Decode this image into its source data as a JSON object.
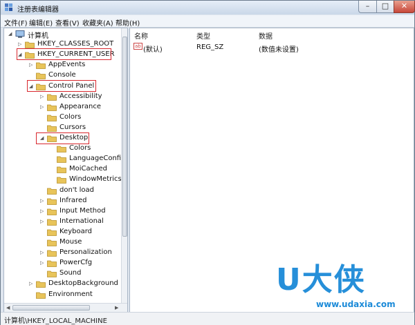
{
  "window": {
    "title": "注册表编辑器"
  },
  "window_controls": {
    "minimize": "–",
    "maximize": "□",
    "close": "✕"
  },
  "menu": [
    "文件(F)",
    "编辑(E)",
    "查看(V)",
    "收藏夹(A)",
    "帮助(H)"
  ],
  "tree": [
    {
      "label": "计算机",
      "arrow": "◢",
      "icon": "computer-icon"
    },
    {
      "label": "HKEY_CLASSES_ROOT",
      "arrow": "▷"
    },
    {
      "label": "HKEY_CURRENT_USER",
      "arrow": "◢"
    },
    {
      "label": "AppEvents",
      "arrow": "▷"
    },
    {
      "label": "Console",
      "arrow": ""
    },
    {
      "label": "Control Panel",
      "arrow": "◢"
    },
    {
      "label": "Accessibility",
      "arrow": "▷"
    },
    {
      "label": "Appearance",
      "arrow": "▷"
    },
    {
      "label": "Colors",
      "arrow": ""
    },
    {
      "label": "Cursors",
      "arrow": ""
    },
    {
      "label": "Desktop",
      "arrow": "◢"
    },
    {
      "label": "Colors",
      "arrow": ""
    },
    {
      "label": "LanguageConfig",
      "arrow": ""
    },
    {
      "label": "MoiCached",
      "arrow": ""
    },
    {
      "label": "WindowMetrics",
      "arrow": ""
    },
    {
      "label": "don't load",
      "arrow": ""
    },
    {
      "label": "Infrared",
      "arrow": "▷"
    },
    {
      "label": "Input Method",
      "arrow": "▷"
    },
    {
      "label": "International",
      "arrow": "▷"
    },
    {
      "label": "Keyboard",
      "arrow": ""
    },
    {
      "label": "Mouse",
      "arrow": ""
    },
    {
      "label": "Personalization",
      "arrow": "▷"
    },
    {
      "label": "PowerCfg",
      "arrow": "▷"
    },
    {
      "label": "Sound",
      "arrow": ""
    },
    {
      "label": "DesktopBackground",
      "arrow": "▷"
    },
    {
      "label": "Environment",
      "arrow": ""
    }
  ],
  "values": {
    "columns": {
      "name": "名称",
      "type": "类型",
      "data": "数据"
    },
    "rows": [
      {
        "icon": "ab",
        "name": "(默认)",
        "type": "REG_SZ",
        "data": "(数值未设置)"
      }
    ]
  },
  "status": {
    "path": "计算机\\HKEY_LOCAL_MACHINE"
  },
  "watermark": {
    "brand": "U大侠",
    "url": "www.udaxia.com"
  },
  "colors": {
    "highlight": "#d8262c",
    "folder": "#e8c45a",
    "watermark": "#1b8ad8"
  }
}
